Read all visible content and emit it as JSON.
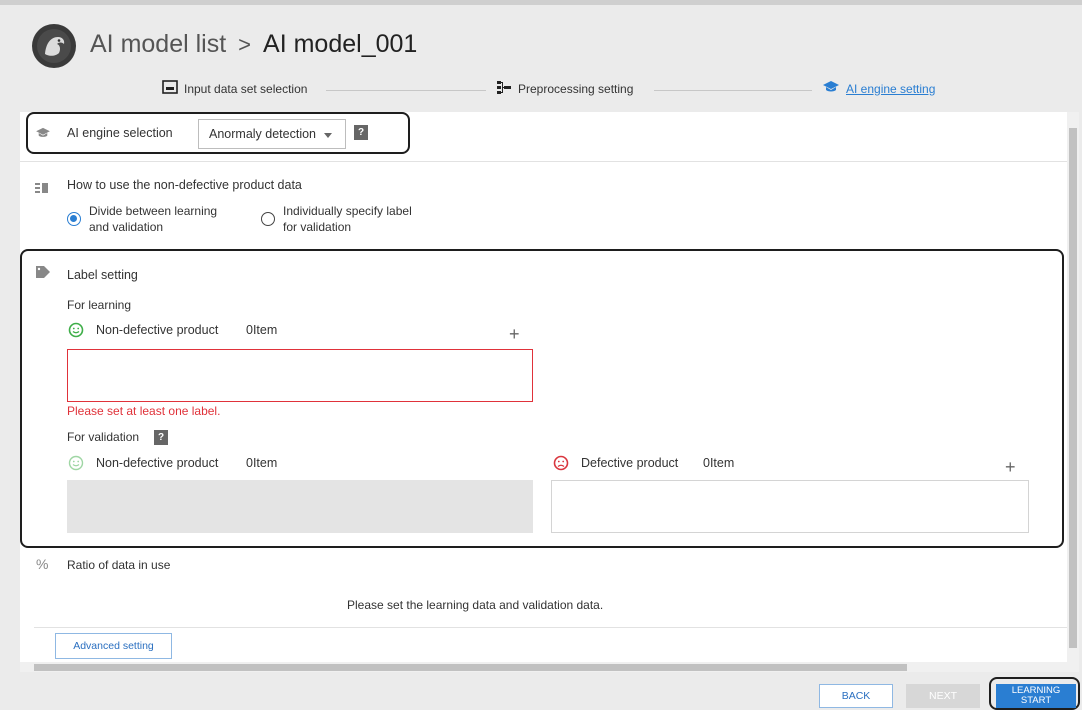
{
  "header": {
    "breadcrumb_root": "AI model list",
    "separator": ">",
    "current": "AI model_001"
  },
  "stepper": {
    "steps": [
      {
        "label": "Input data set selection",
        "icon": "image-frame-icon"
      },
      {
        "label": "Preprocessing setting",
        "icon": "hierarchy-icon"
      },
      {
        "label": "AI engine setting",
        "icon": "graduation-cap-icon",
        "active": true
      }
    ]
  },
  "engine": {
    "label": "AI engine selection",
    "selected": "Anormaly detection",
    "help": "?"
  },
  "usage": {
    "title": "How to use the non-defective product data",
    "options": [
      {
        "line1": "Divide between learning",
        "line2": "and validation",
        "selected": true
      },
      {
        "line1": "Individually specify label",
        "line2": "for validation",
        "selected": false
      }
    ]
  },
  "label_setting": {
    "title": "Label setting",
    "learning": {
      "title": "For learning",
      "non_defective_label": "Non-defective product",
      "non_defective_count": "0Item",
      "plus": "+",
      "error": "Please set at least one label."
    },
    "validation": {
      "title": "For validation",
      "help": "?",
      "non_defective_label": "Non-defective product",
      "non_defective_count": "0Item",
      "defective_label": "Defective product",
      "defective_count": "0Item",
      "plus": "+"
    }
  },
  "ratio": {
    "icon_text": "%",
    "title": "Ratio of data in use",
    "message": "Please set the learning data and validation data."
  },
  "advanced_button": "Advanced setting",
  "footer": {
    "back": "BACK",
    "next": "NEXT",
    "start_line1": "LEARNING",
    "start_line2": "START"
  },
  "colors": {
    "accent": "#2a7ed2",
    "error": "#e0323a",
    "smile": "#3fae49",
    "frown": "#d9363e"
  }
}
